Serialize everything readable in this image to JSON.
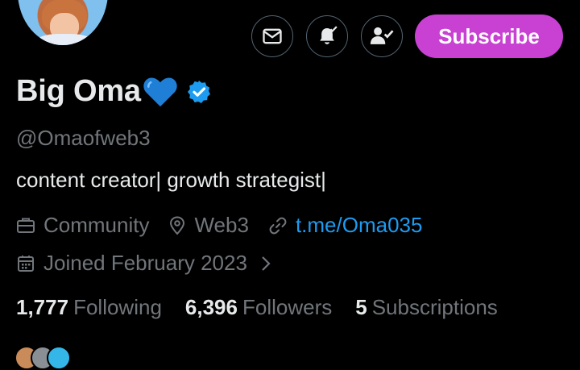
{
  "profile": {
    "display_name": "Big Oma",
    "name_emoji": "💙",
    "handle": "@Omaofweb3",
    "bio": "content creator| growth strategist|",
    "category": "Community",
    "location": "Web3",
    "website": "t.me/Oma035",
    "joined": "Joined February 2023"
  },
  "actions": {
    "message_icon": "envelope-icon",
    "notifications_icon": "bell-check-icon",
    "follow_icon": "person-check-icon",
    "subscribe_label": "Subscribe"
  },
  "stats": {
    "following_count": "1,777",
    "following_label": "Following",
    "followers_count": "6,396",
    "followers_label": "Followers",
    "subscriptions_count": "5",
    "subscriptions_label": "Subscriptions"
  },
  "colors": {
    "background": "#000000",
    "primary_text": "#e7e9ea",
    "secondary_text": "#71767b",
    "link": "#1d9bf0",
    "subscribe": "#c841d3",
    "verified": "#1d9bf0"
  }
}
